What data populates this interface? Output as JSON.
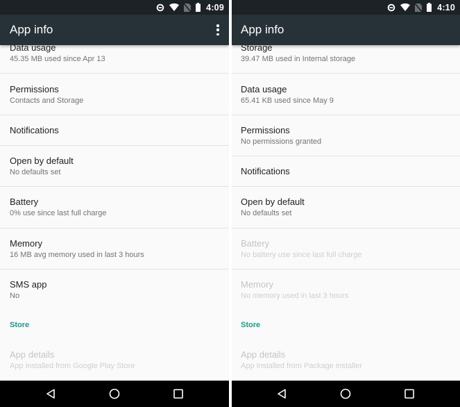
{
  "screens": [
    {
      "status_bar": {
        "time": "4:09",
        "icons": [
          "do-not-disturb-icon",
          "wifi-icon",
          "no-sim-icon",
          "battery-icon"
        ]
      },
      "toolbar": {
        "title": "App info",
        "overflow_icon": "overflow-menu-icon"
      },
      "rows": [
        {
          "title": "Data usage",
          "subtitle": "45.35 MB used since Apr 13",
          "enabled": true
        },
        {
          "title": "Permissions",
          "subtitle": "Contacts and Storage",
          "enabled": true
        },
        {
          "title": "Notifications",
          "subtitle": "",
          "enabled": true
        },
        {
          "title": "Open by default",
          "subtitle": "No defaults set",
          "enabled": true
        },
        {
          "title": "Battery",
          "subtitle": "0% use since last full charge",
          "enabled": true
        },
        {
          "title": "Memory",
          "subtitle": "16 MB avg memory used in last 3 hours",
          "enabled": true
        },
        {
          "title": "SMS app",
          "subtitle": "No",
          "enabled": true
        }
      ],
      "section_header": "Store",
      "store_row": {
        "title": "App details",
        "subtitle": "App installed from Google Play Store",
        "enabled": false
      },
      "nav_bar": {
        "back": "back-icon",
        "home": "home-icon",
        "recents": "recents-icon"
      }
    },
    {
      "status_bar": {
        "time": "4:10",
        "icons": [
          "do-not-disturb-icon",
          "wifi-icon",
          "no-sim-icon",
          "battery-icon"
        ]
      },
      "toolbar": {
        "title": "App info"
      },
      "rows": [
        {
          "title": "Storage",
          "subtitle": "39.47 MB used in Internal storage",
          "enabled": true
        },
        {
          "title": "Data usage",
          "subtitle": "65.41 KB used since May 9",
          "enabled": true
        },
        {
          "title": "Permissions",
          "subtitle": "No permissions granted",
          "enabled": true
        },
        {
          "title": "Notifications",
          "subtitle": "",
          "enabled": true
        },
        {
          "title": "Open by default",
          "subtitle": "No defaults set",
          "enabled": true
        },
        {
          "title": "Battery",
          "subtitle": "No battery use since last full charge",
          "enabled": false
        },
        {
          "title": "Memory",
          "subtitle": "No memory used in last 3 hours",
          "enabled": false
        }
      ],
      "section_header": "Store",
      "store_row": {
        "title": "App details",
        "subtitle": "App installed from Package installer",
        "enabled": false
      },
      "nav_bar": {
        "back": "back-icon",
        "home": "home-icon",
        "recents": "recents-icon"
      }
    }
  ],
  "colors": {
    "status_bar": "#1c2226",
    "toolbar": "#263238",
    "list_background": "#fafafa",
    "section_accent": "#1c9b8c",
    "nav_bar": "#000000"
  }
}
